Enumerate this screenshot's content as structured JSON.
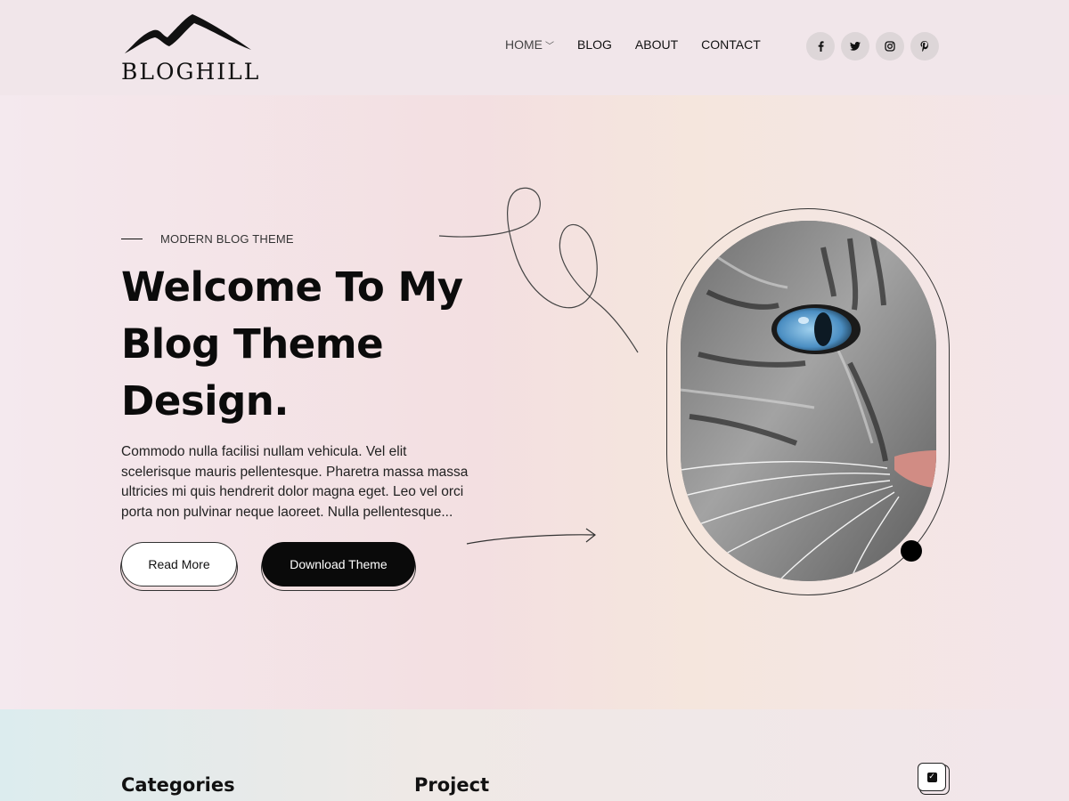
{
  "brand": {
    "name": "BLOGHILL"
  },
  "nav": {
    "items": [
      {
        "label": "HOME",
        "has_dropdown": true,
        "active": true
      },
      {
        "label": "BLOG"
      },
      {
        "label": "ABOUT"
      },
      {
        "label": "CONTACT"
      }
    ]
  },
  "socials": [
    {
      "icon": "facebook-icon",
      "glyph": "f"
    },
    {
      "icon": "twitter-icon",
      "glyph": "🐦"
    },
    {
      "icon": "instagram-icon",
      "glyph": "◎"
    },
    {
      "icon": "pinterest-icon",
      "glyph": "℗"
    }
  ],
  "hero": {
    "eyebrow": "MODERN BLOG THEME",
    "title": "Welcome To My Blog Theme Design.",
    "text": "Commodo nulla facilisi nullam vehicula. Vel elit scelerisque mauris pellentesque. Pharetra massa massa ultricies mi quis hendrerit dolor magna eget. Leo vel orci porta non pulvinar neque laoreet. Nulla pellentesque...",
    "read_more": "Read More",
    "download": "Download Theme",
    "image_subject": "cat-closeup"
  },
  "bottom": {
    "categories_heading": "Categories",
    "project_heading": "Project"
  },
  "colors": {
    "primary": "#0a0a0a",
    "header_bg": "#f1e6ea",
    "social_bg": "#ddd6d8"
  }
}
